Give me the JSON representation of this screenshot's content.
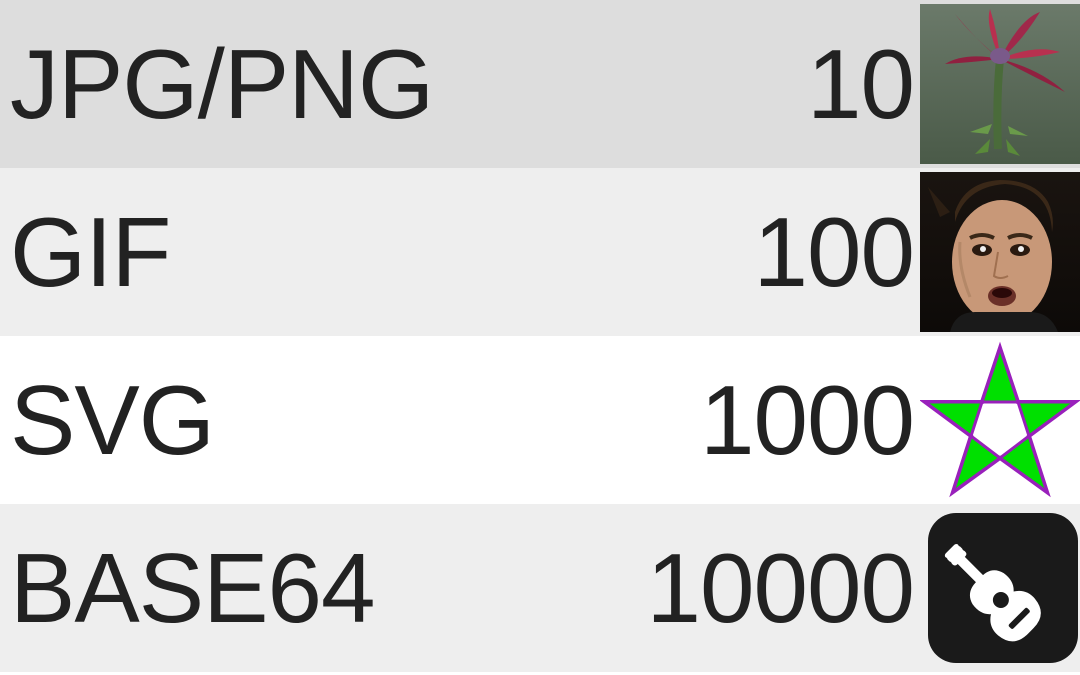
{
  "rows": [
    {
      "label": "JPG/PNG",
      "value": "10",
      "icon": "flower-icon"
    },
    {
      "label": "GIF",
      "value": "100",
      "icon": "face-icon"
    },
    {
      "label": "SVG",
      "value": "1000",
      "icon": "star-icon"
    },
    {
      "label": "BASE64",
      "value": "10000",
      "icon": "guitar-icon"
    }
  ]
}
